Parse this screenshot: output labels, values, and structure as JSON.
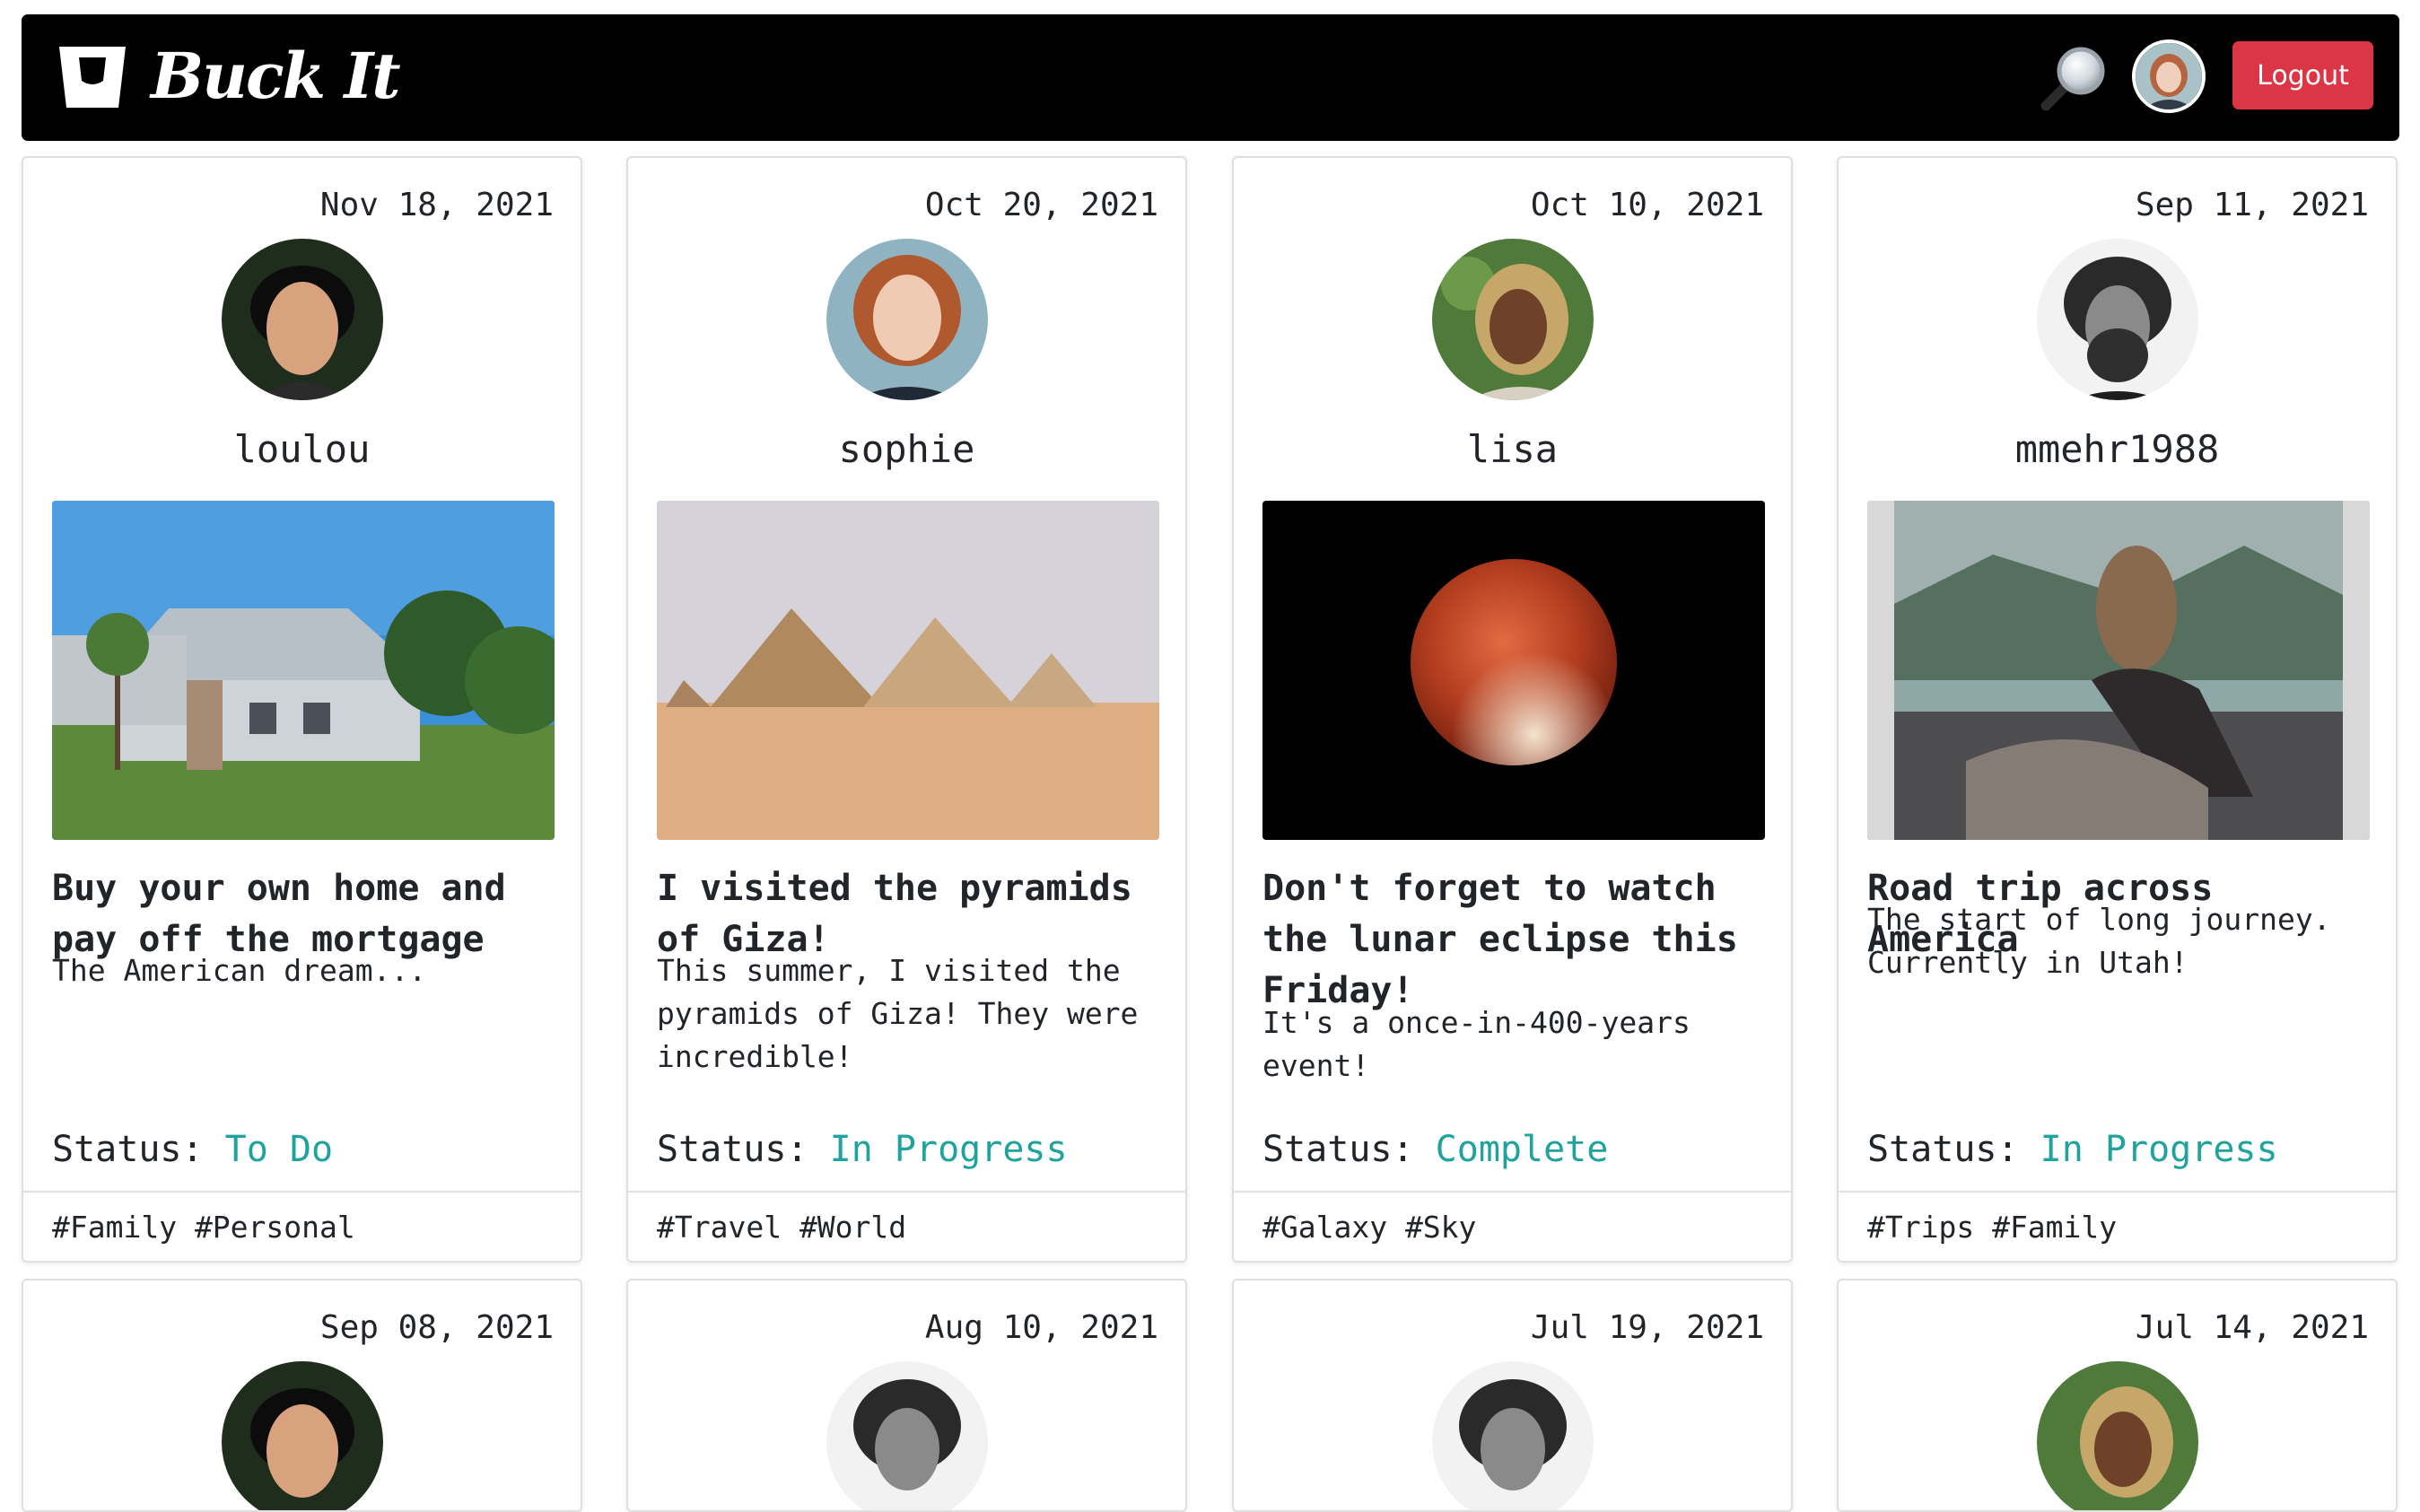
{
  "app": {
    "brand": "Buck It",
    "logout_label": "Logout"
  },
  "posts": [
    {
      "date": "Nov 18, 2021",
      "username": "loulou",
      "title": "Buy your own home and pay off the mortgage",
      "description": "The American dream...",
      "status_label": "Status: ",
      "status": "To Do",
      "tags": "#Family #Personal"
    },
    {
      "date": "Oct 20, 2021",
      "username": "sophie",
      "title": "I visited the pyramids of Giza!",
      "description": "This summer, I visited the pyramids of Giza! They were incredible!",
      "status_label": "Status: ",
      "status": "In Progress",
      "tags": "#Travel #World"
    },
    {
      "date": "Oct 10, 2021",
      "username": "lisa",
      "title": "Don't forget to watch the lunar eclipse this Friday!",
      "description": "It's a once-in-400-years event!",
      "status_label": "Status: ",
      "status": "Complete",
      "tags": "#Galaxy #Sky"
    },
    {
      "date": "Sep 11, 2021",
      "username": "mmehr1988",
      "title": "Road trip across America",
      "description": "The start of long journey. Currently in Utah!",
      "status_label": "Status: ",
      "status": "In Progress",
      "tags": "#Trips #Family"
    }
  ],
  "posts_row2": [
    {
      "date": "Sep 08, 2021"
    },
    {
      "date": "Aug 10, 2021"
    },
    {
      "date": "Jul 19, 2021"
    },
    {
      "date": "Jul 14, 2021"
    }
  ],
  "colors": {
    "status": "#20a39e",
    "logout": "#dc3545",
    "navbar": "#000000"
  }
}
